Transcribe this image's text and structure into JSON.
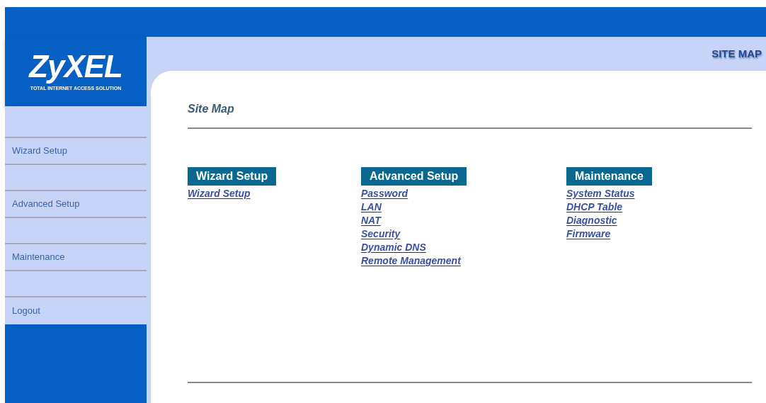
{
  "logo": {
    "brand": "ZyXEL",
    "tagline": "TOTAL INTERNET ACCESS SOLUTION"
  },
  "sidebar": {
    "items": [
      {
        "label": "Wizard Setup"
      },
      {
        "label": "Advanced Setup"
      },
      {
        "label": "Maintenance"
      },
      {
        "label": "Logout"
      }
    ]
  },
  "header": {
    "title": "SITE MAP"
  },
  "content": {
    "title": "Site Map",
    "sections": [
      {
        "heading": "Wizard Setup",
        "links": [
          "Wizard Setup"
        ]
      },
      {
        "heading": "Advanced Setup",
        "links": [
          "Password",
          "LAN",
          "NAT",
          "Security",
          "Dynamic DNS",
          "Remote Management"
        ]
      },
      {
        "heading": "Maintenance",
        "links": [
          "System Status",
          "DHCP Table",
          "Diagnostic",
          "Firmware"
        ]
      }
    ]
  }
}
